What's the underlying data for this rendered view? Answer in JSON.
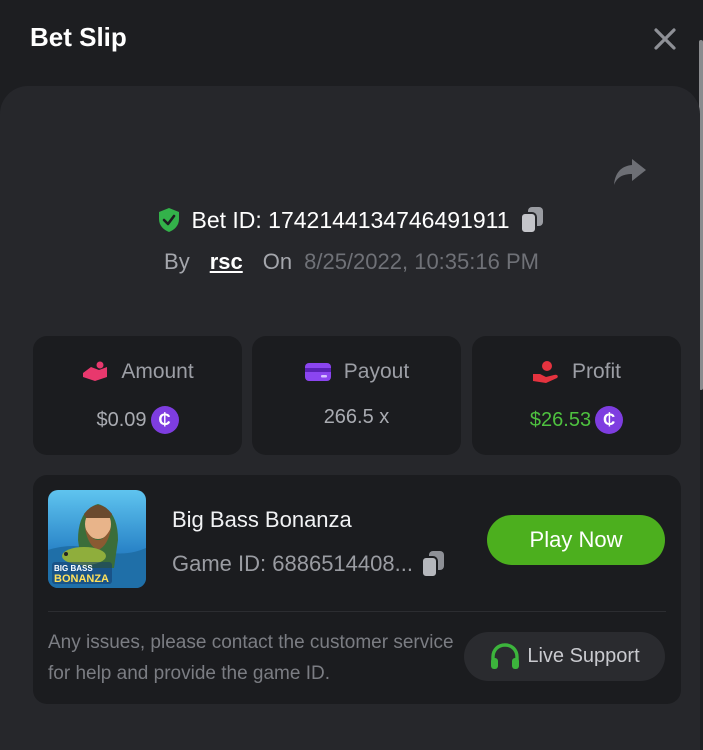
{
  "header": {
    "title": "Bet Slip"
  },
  "bet": {
    "id_label": "Bet ID: 1742144134746491911",
    "by_label": "By",
    "user": "rsc",
    "on_label": "On",
    "date": "8/25/2022, 10:35:16 PM"
  },
  "stats": {
    "amount": {
      "label": "Amount",
      "value": "$0.09"
    },
    "payout": {
      "label": "Payout",
      "value": "266.5 x"
    },
    "profit": {
      "label": "Profit",
      "value": "$26.53"
    },
    "coin_symbol": "₵"
  },
  "game": {
    "name": "Big Bass Bonanza",
    "id_label": "Game ID: 6886514408...",
    "play_label": "Play Now",
    "thumb_title_top": "BIG BASS",
    "thumb_title_bottom": "BONANZA"
  },
  "support": {
    "text": "Any issues, please contact the customer service for help and provide the game ID.",
    "button_label": "Live Support"
  },
  "colors": {
    "background": "#1d1e21",
    "panel": "#26272b",
    "card": "#1b1c1f",
    "accent_green": "#4caf1e",
    "profit_green": "#4ec13f",
    "coin_purple": "#7e3de0",
    "shield_green": "#33b24a"
  },
  "icons": [
    "close-icon",
    "share-icon",
    "shield-check-icon",
    "copy-icon",
    "amount-icon",
    "payout-card-icon",
    "profit-icon",
    "coin-icon",
    "headset-icon"
  ]
}
